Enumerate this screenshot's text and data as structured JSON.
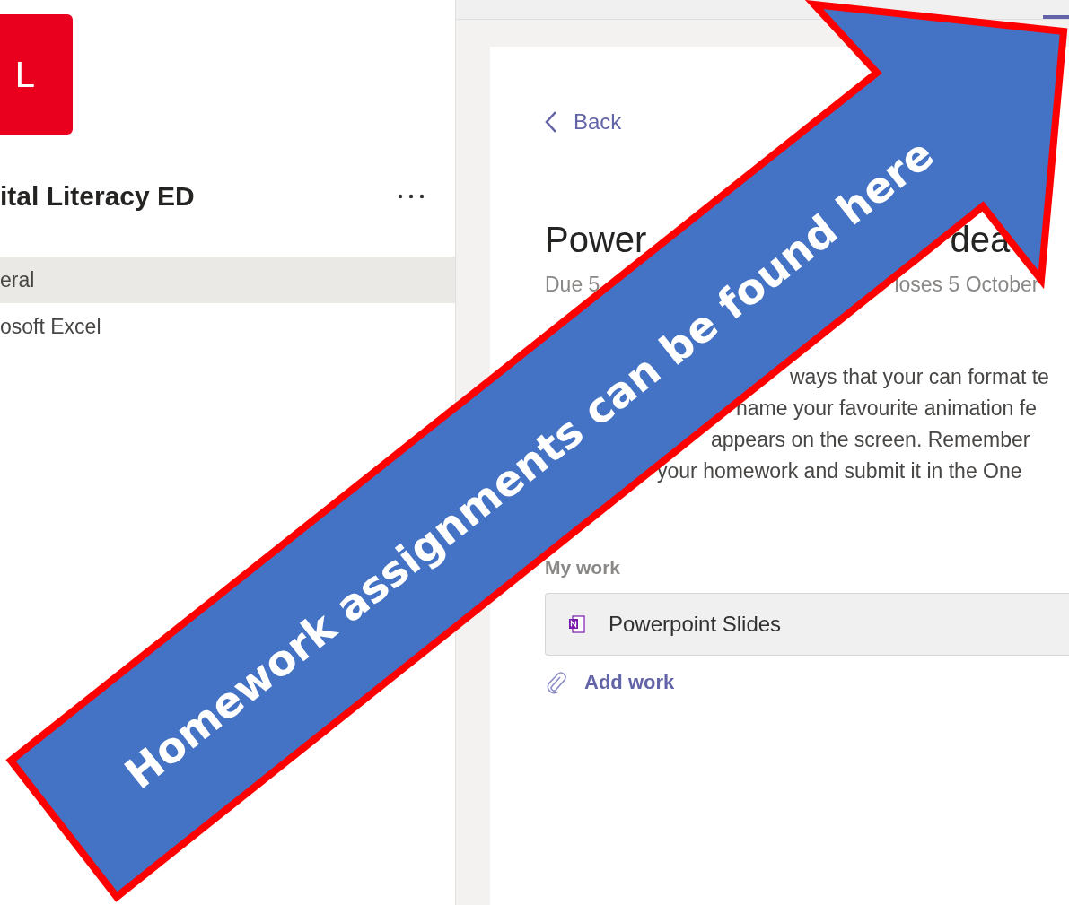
{
  "sidebar": {
    "logo_text": "L",
    "team_name": "ital Literacy ED",
    "channels": [
      {
        "label": "eral",
        "selected": true
      },
      {
        "label": "osoft Excel",
        "selected": false
      }
    ]
  },
  "assignment": {
    "back": "Back",
    "title_parts": [
      "Power",
      "dea"
    ],
    "due_parts": [
      "Due 5",
      "loses 5 October"
    ],
    "description_lines": [
      "ways that your can format te",
      "name your favourite animation fe",
      "appears on the screen. Remember",
      "your homework and submit it in the One"
    ],
    "my_work_label": "My work",
    "attachments": [
      {
        "name": "Powerpoint Slides"
      }
    ],
    "add_work": "Add work"
  },
  "callout": {
    "text": "Homework assignments can be found here"
  }
}
